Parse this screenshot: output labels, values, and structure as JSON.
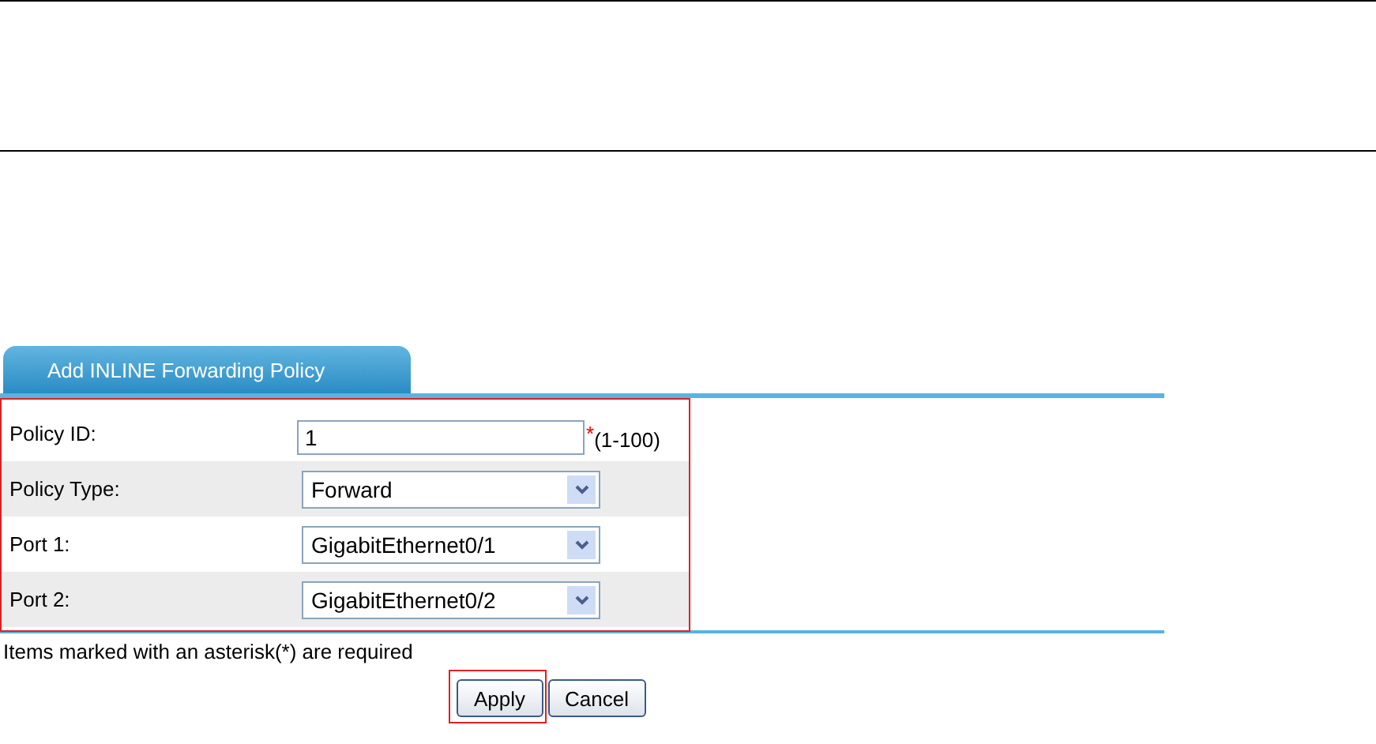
{
  "tabs": [
    {
      "label": "Add INLINE Forwarding Policy",
      "selected": true
    }
  ],
  "fields": [
    {
      "kind": "text",
      "label": "Policy ID:",
      "value": "1",
      "required": true,
      "required_marker": "*",
      "hint": "(1-100)"
    },
    {
      "kind": "select",
      "label": "Policy Type:",
      "value": "Forward"
    },
    {
      "kind": "select",
      "label": "Port 1:",
      "value": "GigabitEthernet0/1"
    },
    {
      "kind": "select",
      "label": "Port 2:",
      "value": "GigabitEthernet0/2"
    }
  ],
  "note": "Items marked with an asterisk(*) are required",
  "buttons": [
    {
      "label": "Apply",
      "highlighted": true
    },
    {
      "label": "Cancel",
      "highlighted": false
    }
  ],
  "form_highlighted": true
}
